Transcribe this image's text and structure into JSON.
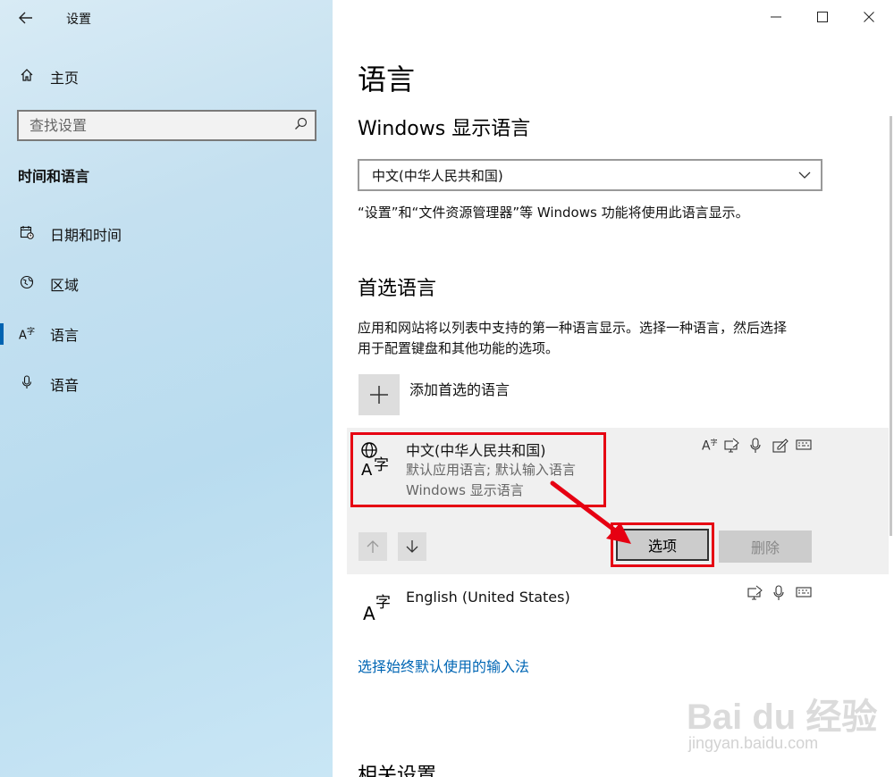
{
  "window": {
    "title": "设置",
    "back_icon": "arrow-left-icon",
    "minimize": "—",
    "maximize": "☐",
    "close": "✕"
  },
  "sidebar": {
    "home_label": "主页",
    "search_placeholder": "查找设置",
    "section": "时间和语言",
    "items": [
      {
        "label": "日期和时间",
        "icon": "calendar-clock-icon"
      },
      {
        "label": "区域",
        "icon": "globe-region-icon"
      },
      {
        "label": "语言",
        "icon": "language-icon"
      },
      {
        "label": "语音",
        "icon": "microphone-icon"
      }
    ]
  },
  "main": {
    "title": "语言",
    "display_lang_heading": "Windows 显示语言",
    "display_lang_value": "中文(中华人民共和国)",
    "display_lang_note": "“设置”和“文件资源管理器”等 Windows 功能将使用此语言显示。",
    "preferred_heading": "首选语言",
    "preferred_note_line1": "应用和网站将以列表中支持的第一种语言显示。选择一种语言，然后选择",
    "preferred_note_line2": "用于配置键盘和其他功能的选项。",
    "add_label": "添加首选的语言",
    "languages": [
      {
        "name": "中文(中华人民共和国)",
        "sub1": "默认应用语言; 默认输入语言",
        "sub2": "Windows 显示语言"
      },
      {
        "name": "English (United States)"
      }
    ],
    "options_label": "选项",
    "remove_label": "删除",
    "link_default_ime": "选择始终默认使用的输入法",
    "related_heading": "相关设置"
  },
  "watermark": {
    "brand": "Bai du 经验",
    "url": "jingyan.baidu.com"
  },
  "colors": {
    "accent": "#0063b1",
    "highlight": "#e60012",
    "link": "#0066b4"
  }
}
